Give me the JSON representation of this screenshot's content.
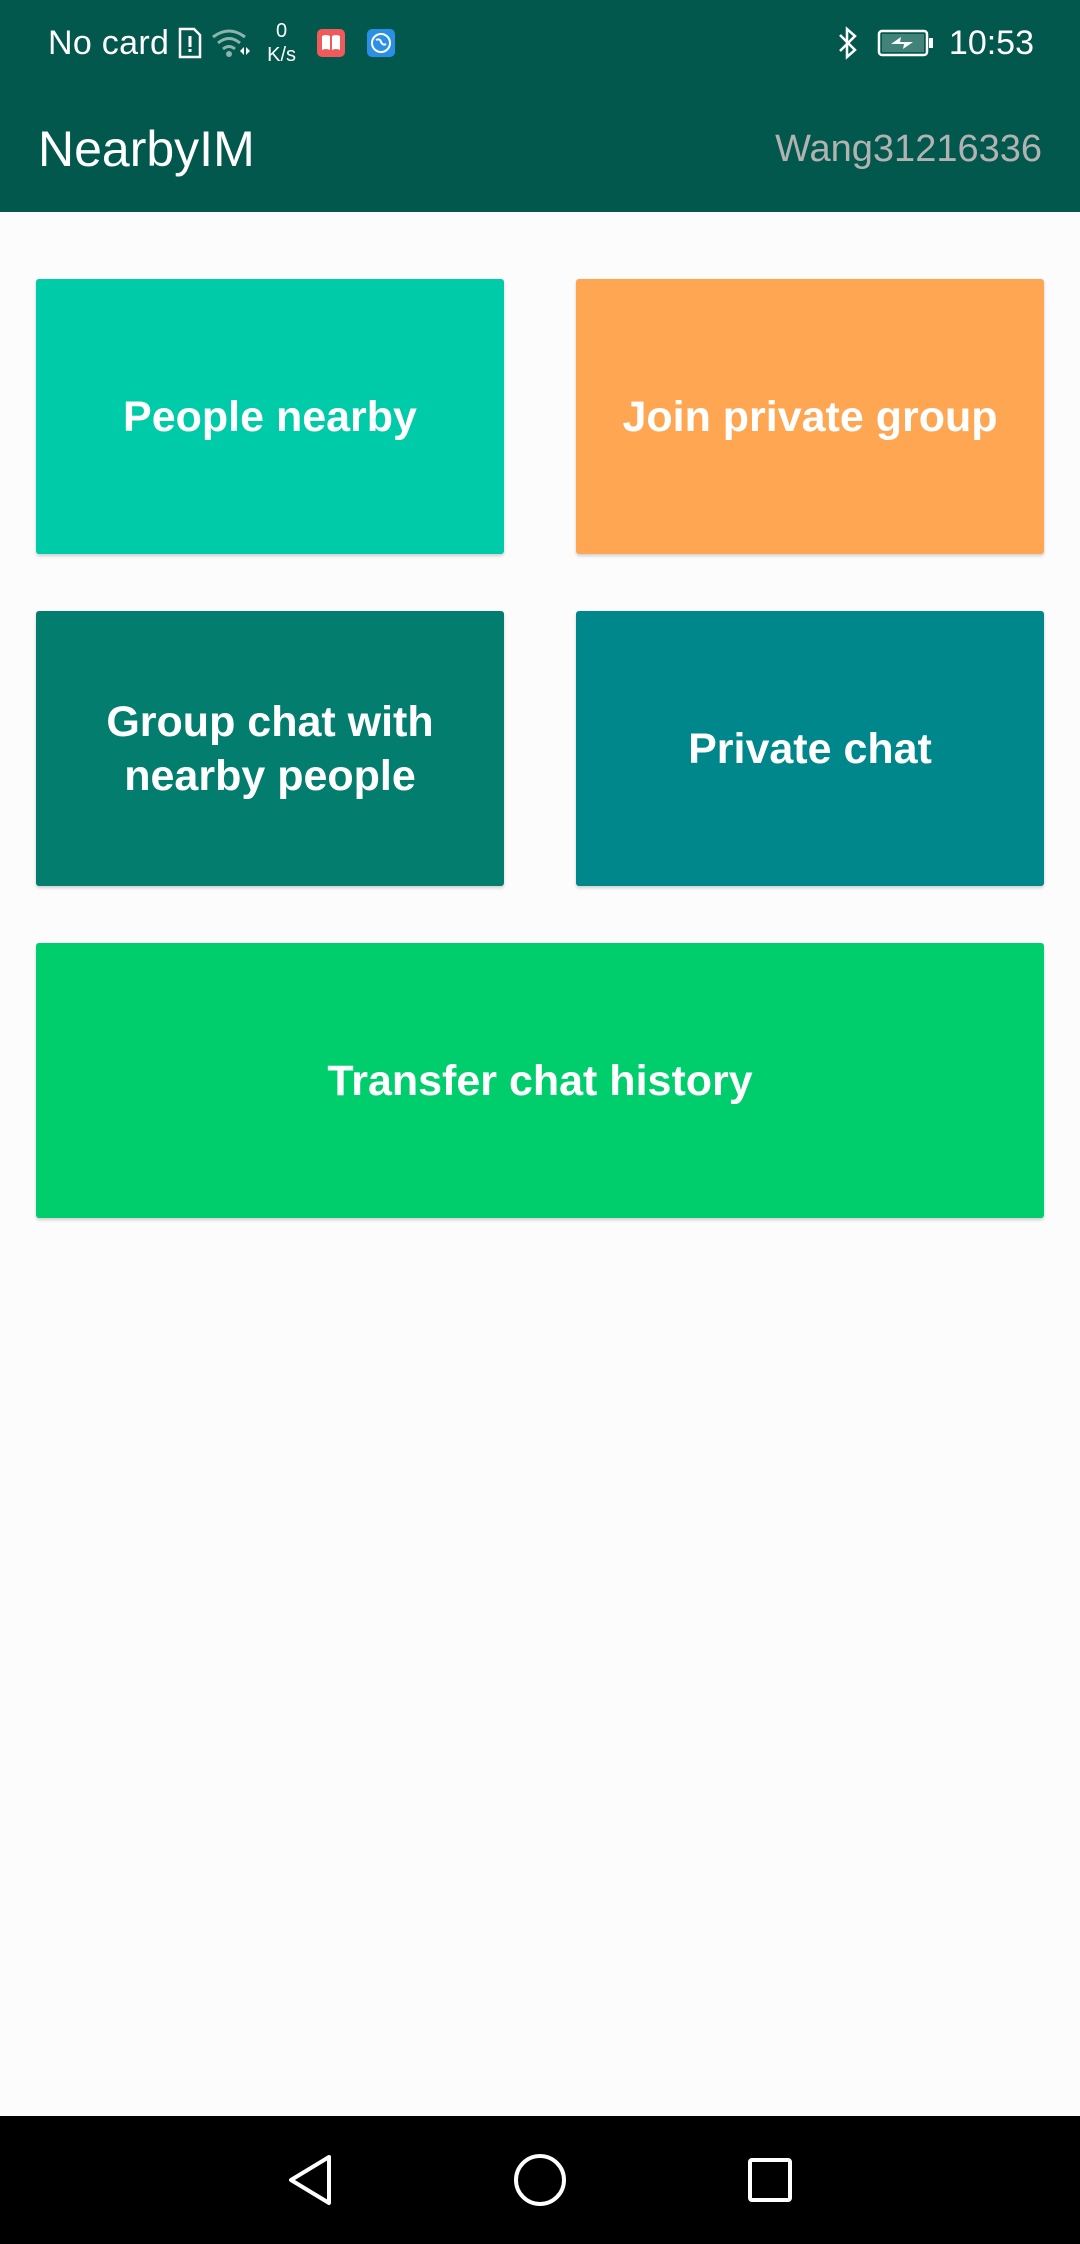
{
  "status_bar": {
    "carrier": "No card",
    "net_speed_value": "0",
    "net_speed_unit": "K/s",
    "time": "10:53",
    "icons": [
      "sim-alert-icon",
      "wifi-icon",
      "book-app-icon",
      "browser-app-icon",
      "bluetooth-icon",
      "battery-charging-icon"
    ]
  },
  "app_bar": {
    "title": "NearbyIM",
    "user_id": "Wang31216336"
  },
  "tiles": {
    "people_nearby": "People nearby",
    "join_private_group": "Join private group",
    "group_chat_line1": "Group chat with",
    "group_chat_line2": "nearby people",
    "private_chat": "Private chat",
    "transfer_history": "Transfer chat history"
  },
  "colors": {
    "app_bar": "#02584c",
    "people_nearby": "#00cba8",
    "join_private_group": "#ffa653",
    "group_chat": "#027d6e",
    "private_chat": "#00878c",
    "transfer_history": "#00cd6b"
  },
  "nav_bar": {
    "icons": [
      "back-icon",
      "home-icon",
      "recent-apps-icon"
    ]
  }
}
